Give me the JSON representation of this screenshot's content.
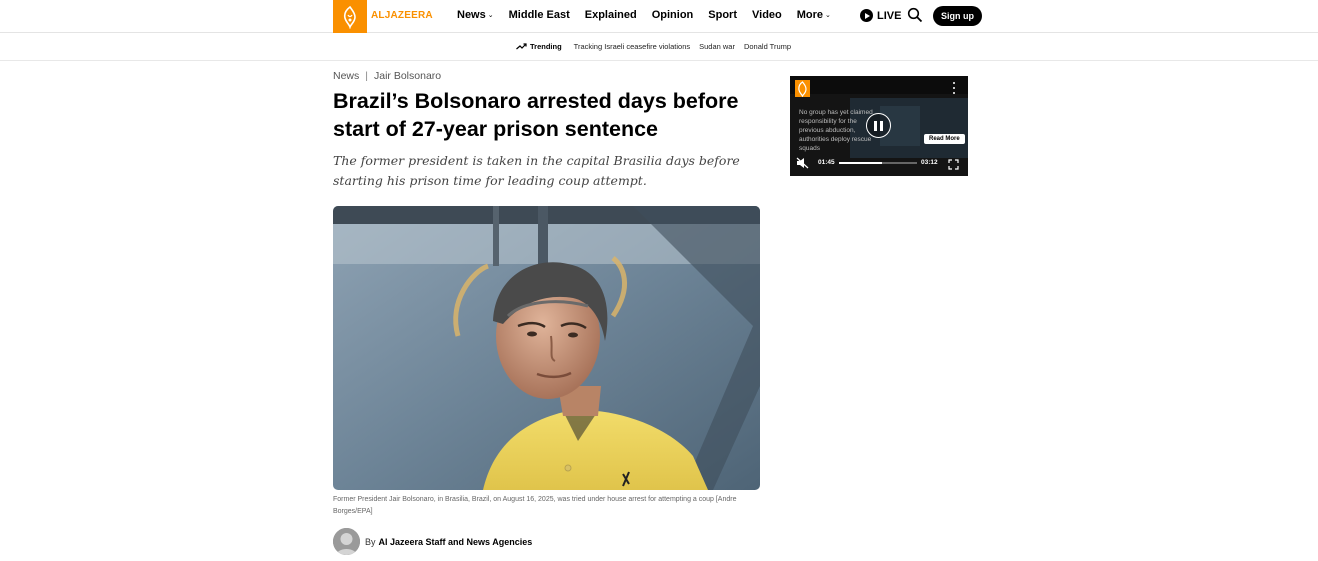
{
  "header": {
    "logo_text": "ALJAZEERA",
    "nav": [
      {
        "label": "News",
        "has_dropdown": true
      },
      {
        "label": "Middle East",
        "has_dropdown": false
      },
      {
        "label": "Explained",
        "has_dropdown": false
      },
      {
        "label": "Opinion",
        "has_dropdown": false
      },
      {
        "label": "Sport",
        "has_dropdown": false
      },
      {
        "label": "Video",
        "has_dropdown": false
      },
      {
        "label": "More",
        "has_dropdown": true
      }
    ],
    "live_label": "LIVE",
    "signup_label": "Sign up",
    "brand_color": "#fa9000"
  },
  "trending": {
    "label": "Trending",
    "links": [
      "Tracking Israeli ceasefire violations",
      "Sudan war",
      "Donald Trump"
    ]
  },
  "article": {
    "breadcrumb": [
      "News",
      "Jair Bolsonaro"
    ],
    "title": "Brazil’s Bolsonaro arrested days before start of 27-year prison sentence",
    "subtitle": "The former president is taken in the capital Brasilia days before starting his prison time for leading coup attempt.",
    "caption": "Former President Jair Bolsonaro, in Brasilia, Brazil, on August 16, 2025, was tried under house arrest for attempting a coup [Andre Borges/EPA]",
    "byline_prefix": "By",
    "author": "Al Jazeera Staff and News Agencies"
  },
  "video": {
    "overlay_text": "No group has yet claimed responsibility for the previous abduction, authorities deploy rescue squads",
    "read_more": "Read More",
    "current_time": "01:45",
    "duration": "03:12",
    "progress": 0.55
  }
}
